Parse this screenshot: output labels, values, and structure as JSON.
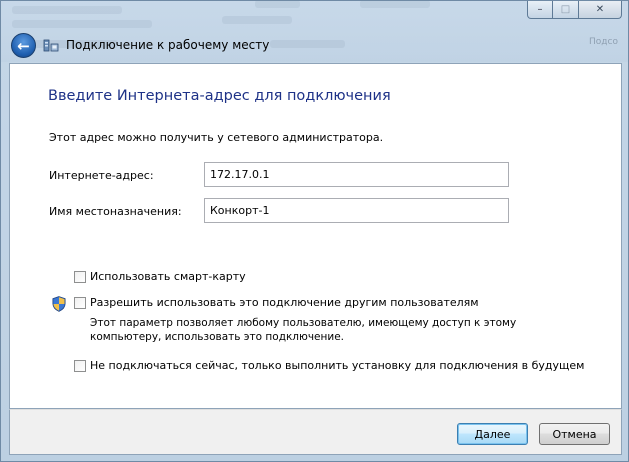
{
  "window": {
    "title": "Подключение к рабочему месту",
    "caption_buttons": {
      "minimize": "–",
      "maximize": "□",
      "close": "✕"
    },
    "back_icon": "back-arrow-icon",
    "title_icon": "network-connection-icon"
  },
  "page": {
    "heading": "Введите Интернета-адрес для подключения",
    "description": "Этот адрес можно получить у сетевого администратора.",
    "internet_address": {
      "label": "Интернете-адрес:",
      "value": "172.17.0.1"
    },
    "destination_name": {
      "label": "Имя местоназначения:",
      "value": "Конкорт-1"
    },
    "options": {
      "smart_card": {
        "label": "Использовать смарт-карту",
        "checked": false
      },
      "allow_others": {
        "label": "Разрешить использовать это подключение другим пользователям",
        "note_line1": "Этот параметр позволяет любому пользователю, имеющему доступ к этому",
        "note_line2": "компьютеру, использовать это подключение.",
        "checked": false,
        "icon": "uac-shield-icon"
      },
      "dont_connect": {
        "label": "Не подключаться сейчас, только выполнить установку для подключения в будущем",
        "checked": false
      }
    }
  },
  "footer": {
    "next_label": "Далее",
    "cancel_label": "Отмена"
  },
  "colors": {
    "heading": "#1e3287",
    "frame": "#c4d4e4",
    "default_button": "#bee6fd"
  }
}
